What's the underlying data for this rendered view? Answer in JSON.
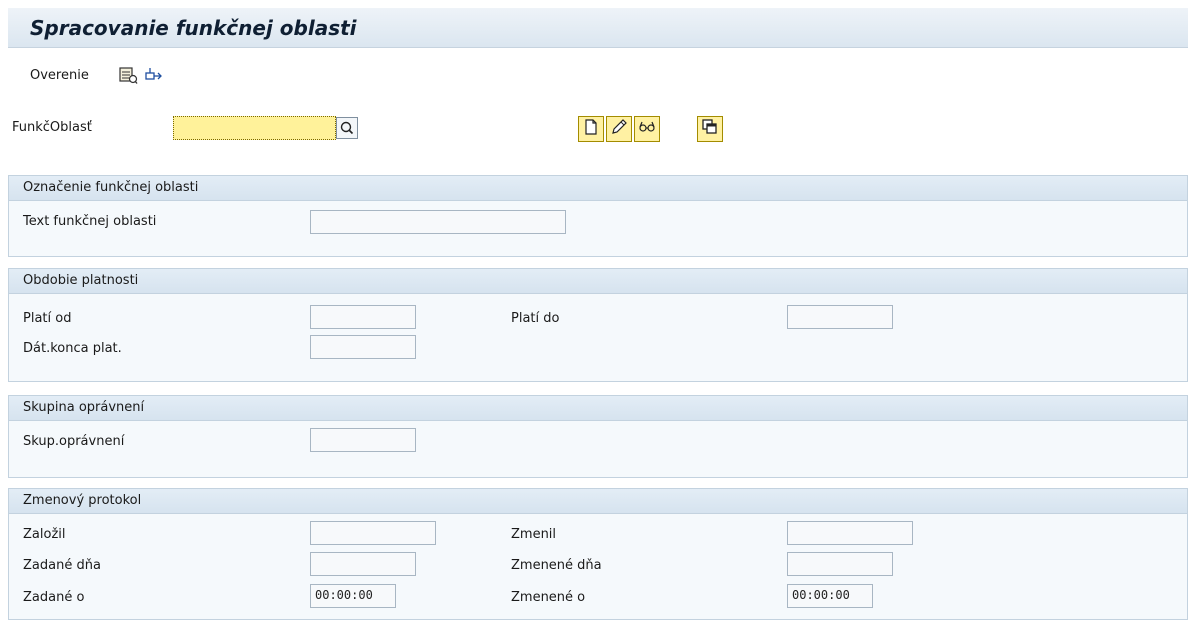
{
  "header": {
    "title": "Spracovanie funkčnej oblasti"
  },
  "toolbar": {
    "overenie_label": "Overenie",
    "icons": [
      "display-list-icon",
      "transport-icon"
    ]
  },
  "selection": {
    "funkc_label": "FunkčOblasť",
    "funkc_value": "",
    "buttons": [
      "create-icon",
      "edit-icon",
      "display-icon",
      "copy-icon"
    ]
  },
  "sections": {
    "designation": {
      "title": "Označenie funkčnej oblasti",
      "text_label": "Text funkčnej oblasti",
      "text_value": ""
    },
    "validity": {
      "title": "Obdobie platnosti",
      "valid_from_label": "Platí od",
      "valid_from_value": "",
      "valid_to_label": "Platí do",
      "valid_to_value": "",
      "end_label": "Dát.konca plat.",
      "end_value": ""
    },
    "authorization": {
      "title": "Skupina oprávnení",
      "group_label": "Skup.oprávnení",
      "group_value": ""
    },
    "change_log": {
      "title": "Zmenový protokol",
      "created_by_label": "Založil",
      "created_by_value": "",
      "changed_by_label": "Zmenil",
      "changed_by_value": "",
      "created_on_label": "Zadané dňa",
      "created_on_value": "",
      "changed_on_label": "Zmenené dňa",
      "changed_on_value": "",
      "created_at_label": "Zadané o",
      "created_at_value": "00:00:00",
      "changed_at_label": "Zmenené o",
      "changed_at_value": "00:00:00"
    }
  },
  "colors": {
    "required_field": "#fff29a",
    "section_header": "#d6e3ef",
    "title_bar": "#dbe6f0"
  }
}
